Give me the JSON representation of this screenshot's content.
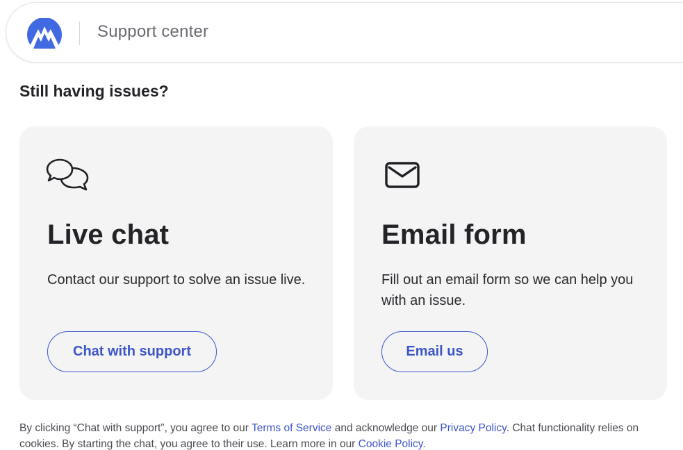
{
  "header": {
    "title": "Support center"
  },
  "section": {
    "title": "Still having issues?"
  },
  "cards": [
    {
      "icon": "chat-bubbles-icon",
      "title": "Live chat",
      "description": "Contact our support to solve an issue live.",
      "button_label": "Chat with support"
    },
    {
      "icon": "envelope-icon",
      "title": "Email form",
      "description": "Fill out an email form so we can help you with an issue.",
      "button_label": "Email us"
    }
  ],
  "footer": {
    "text_1": "By clicking “Chat with support”, you agree to our ",
    "terms_link": "Terms of Service",
    "text_2": " and acknowledge our ",
    "privacy_link": "Privacy Policy",
    "text_3": ". Chat functionality relies on cookies. By starting the chat, you agree to their use. Learn more in our ",
    "cookie_link": "Cookie Policy",
    "text_4": "."
  },
  "colors": {
    "accent": "#3c56c9",
    "logo": "#4169e1",
    "card_bg": "#f4f4f5"
  }
}
